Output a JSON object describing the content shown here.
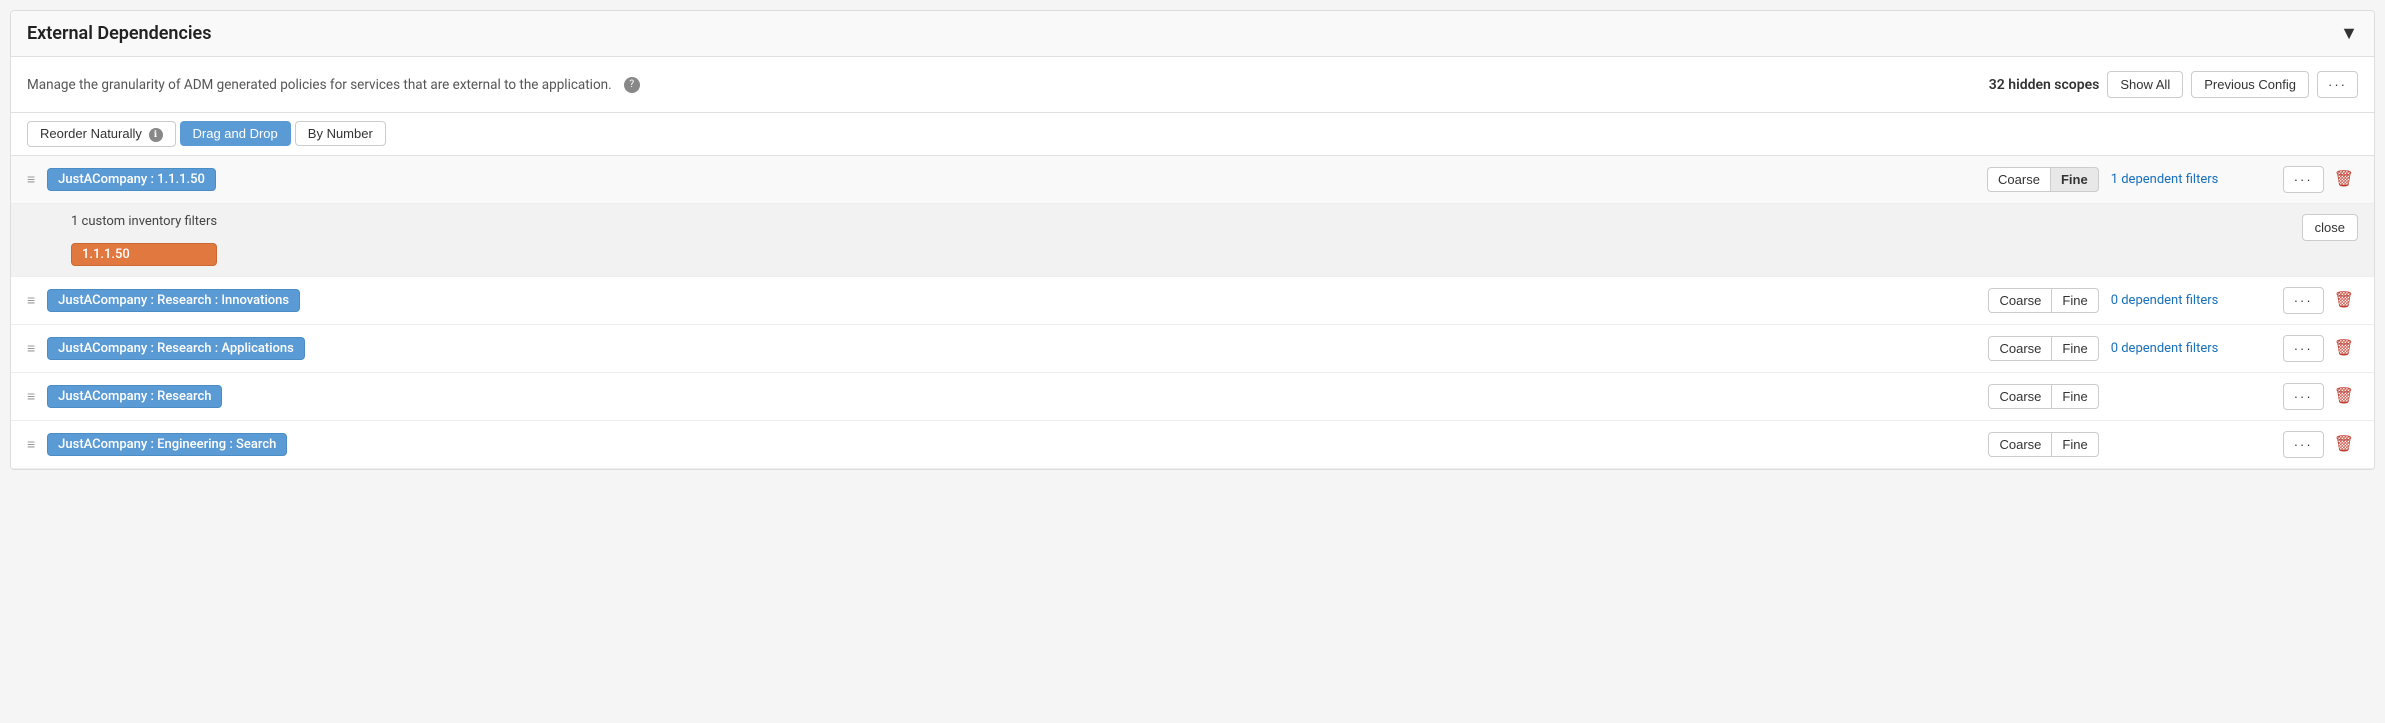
{
  "panel": {
    "title": "External Dependencies",
    "chevron": "▼"
  },
  "toolbar": {
    "description": "Manage the granularity of ADM generated policies for services that are external to the application.",
    "help_tooltip": "?",
    "hidden_scopes_label": "32 hidden scopes",
    "show_all_label": "Show All",
    "previous_config_label": "Previous Config",
    "more_label": "···"
  },
  "reorder": {
    "naturally_label": "Reorder Naturally",
    "naturally_info": "ℹ",
    "drag_drop_label": "Drag and Drop",
    "by_number_label": "By Number",
    "active": "drag_drop"
  },
  "entries": [
    {
      "id": "entry-1",
      "scope": "JustACompany : 1.1.1.50",
      "coarse_label": "Coarse",
      "fine_label": "Fine",
      "active_gran": "fine",
      "dependent_filters": "1 dependent filters",
      "has_subrow": true,
      "subrow": {
        "custom_filters_label": "1 custom inventory filters",
        "badge": "1.1.1.50",
        "close_label": "close"
      }
    },
    {
      "id": "entry-2",
      "scope": "JustACompany : Research : Innovations",
      "coarse_label": "Coarse",
      "fine_label": "Fine",
      "active_gran": "none",
      "dependent_filters": "0 dependent filters",
      "has_subrow": false
    },
    {
      "id": "entry-3",
      "scope": "JustACompany : Research : Applications",
      "coarse_label": "Coarse",
      "fine_label": "Fine",
      "active_gran": "none",
      "dependent_filters": "0 dependent filters",
      "has_subrow": false
    },
    {
      "id": "entry-4",
      "scope": "JustACompany : Research",
      "coarse_label": "Coarse",
      "fine_label": "Fine",
      "active_gran": "none",
      "dependent_filters": "",
      "has_subrow": false
    },
    {
      "id": "entry-5",
      "scope": "JustACompany : Engineering : Search",
      "coarse_label": "Coarse",
      "fine_label": "Fine",
      "active_gran": "none",
      "dependent_filters": "",
      "has_subrow": false
    }
  ],
  "icons": {
    "drag": "≡",
    "delete": "🗑",
    "more": "···",
    "chevron_down": "✔"
  }
}
